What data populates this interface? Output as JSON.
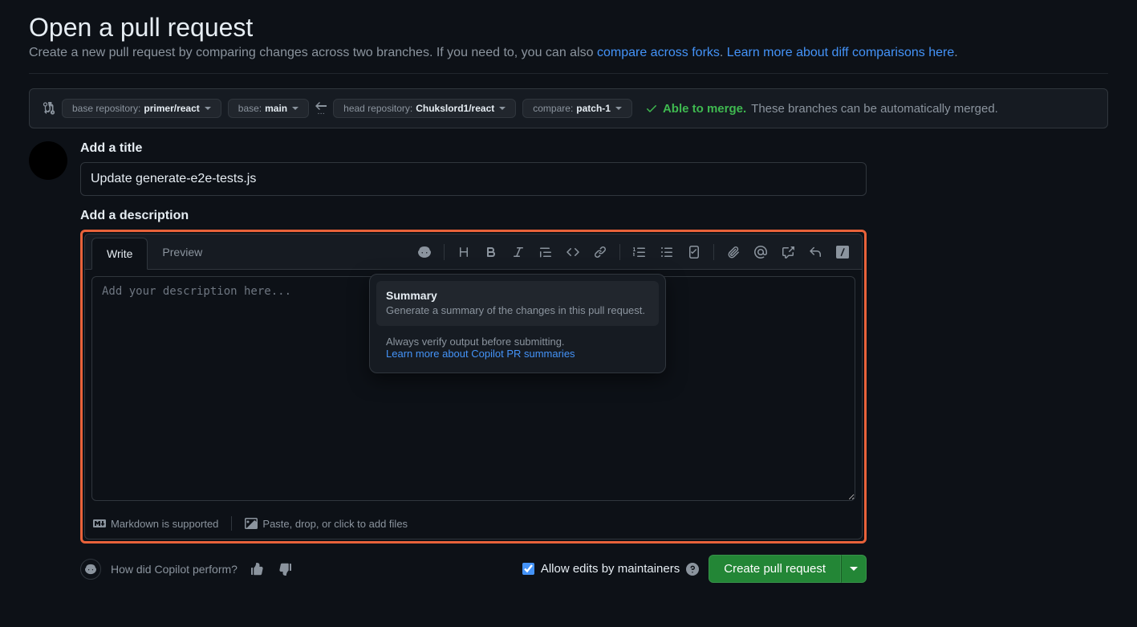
{
  "page": {
    "title": "Open a pull request",
    "subtitle_pre": "Create a new pull request by comparing changes across two branches. If you need to, you can also ",
    "compare_forks_link": "compare across forks",
    "subtitle_mid": ". ",
    "learn_more_link": "Learn more about diff comparisons here",
    "subtitle_end": "."
  },
  "branches": {
    "base_repo_label": "base repository: ",
    "base_repo_value": "primer/react",
    "base_label": "base: ",
    "base_value": "main",
    "head_repo_label": "head repository: ",
    "head_repo_value": "Chukslord1/react",
    "compare_label": "compare: ",
    "compare_value": "patch-1"
  },
  "merge": {
    "able": "Able to merge.",
    "desc": "These branches can be automatically merged."
  },
  "form": {
    "title_label": "Add a title",
    "title_value": "Update generate-e2e-tests.js",
    "desc_label": "Add a description",
    "desc_placeholder": "Add your description here..."
  },
  "tabs": {
    "write": "Write",
    "preview": "Preview"
  },
  "popup": {
    "title": "Summary",
    "desc": "Generate a summary of the changes in this pull request.",
    "note": "Always verify output before submitting.",
    "link": "Learn more about Copilot PR summaries"
  },
  "hints": {
    "markdown": "Markdown is supported",
    "paste": "Paste, drop, or click to add files"
  },
  "feedback": {
    "label": "How did Copilot perform?"
  },
  "allow_edits": "Allow edits by maintainers",
  "create_btn": "Create pull request"
}
